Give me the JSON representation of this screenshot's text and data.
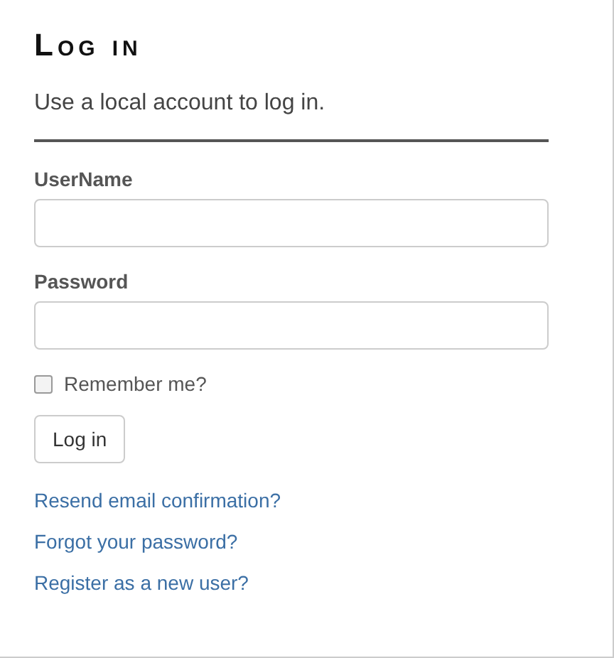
{
  "title": "Log in",
  "subtitle": "Use a local account to log in.",
  "fields": [
    {
      "label": "UserName"
    },
    {
      "label": "Password"
    }
  ],
  "remember": {
    "label": "Remember me?",
    "checked": false
  },
  "submit": "Log in",
  "links": [
    "Resend email confirmation?",
    "Forgot your password?",
    "Register as a new user?"
  ]
}
